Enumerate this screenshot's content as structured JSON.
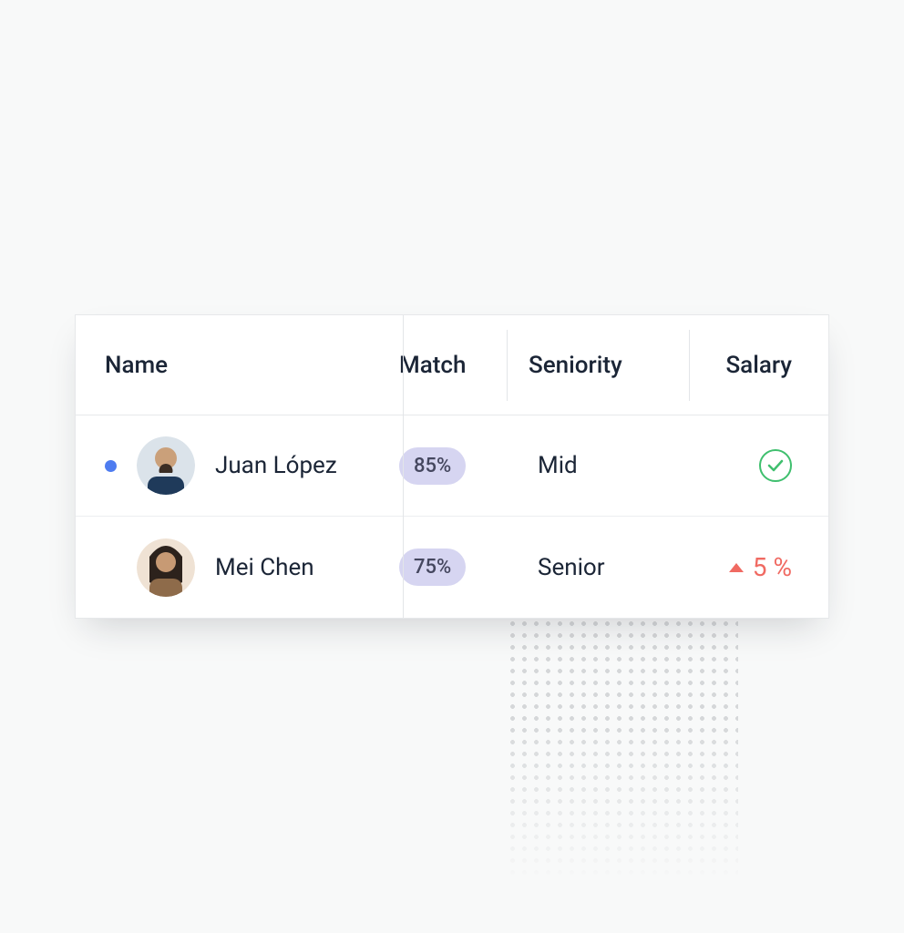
{
  "table": {
    "headers": {
      "name": "Name",
      "match": "Match",
      "seniority": "Seniority",
      "salary": "Salary"
    },
    "rows": [
      {
        "has_indicator": true,
        "name": "Juan López",
        "match": "85%",
        "seniority": "Mid",
        "salary_type": "ok"
      },
      {
        "has_indicator": false,
        "name": "Mei Chen",
        "match": "75%",
        "seniority": "Senior",
        "salary_type": "up",
        "salary_delta": "5 %"
      }
    ]
  },
  "colors": {
    "accent_blue": "#4e7cf0",
    "pill_bg": "#d6d5f1",
    "ok_green": "#3fbf6e",
    "up_red": "#f06a62"
  }
}
